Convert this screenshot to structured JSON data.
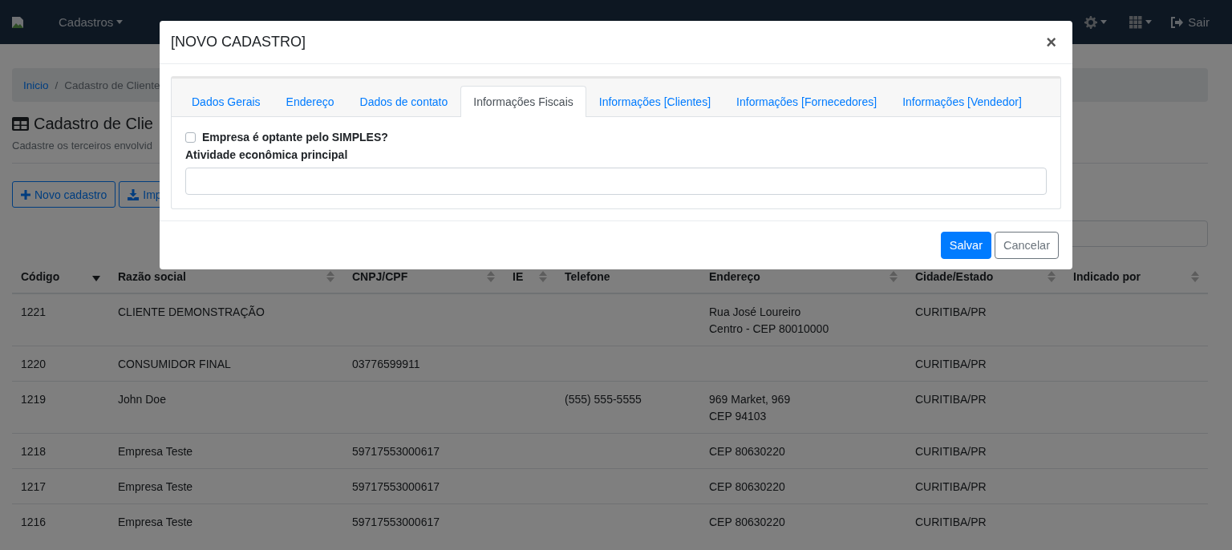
{
  "navbar": {
    "menus": [
      {
        "label": "Cadastros",
        "caret": true
      }
    ],
    "tools": [
      {
        "kind": "gear"
      },
      {
        "kind": "grid"
      }
    ],
    "logout": "Sair"
  },
  "breadcrumb": {
    "separator": "/",
    "items": [
      {
        "label": "Inicio",
        "link": true
      },
      {
        "label": "Cadastro de Cliente",
        "link": false
      }
    ]
  },
  "page": {
    "title": "Cadastro de Clie",
    "subtitle": "Cadastre os terceiros envolvid"
  },
  "actions": [
    {
      "label": "Novo cadastro",
      "kind": "plus"
    },
    {
      "label": "Imp",
      "kind": "download"
    }
  ],
  "table": {
    "columns": [
      {
        "label": "Código",
        "sortable": true,
        "sorted": true
      },
      {
        "label": "Razão social",
        "sortable": true,
        "sorted": false
      },
      {
        "label": "CNPJ/CPF",
        "sortable": true,
        "sorted": false
      },
      {
        "label": "IE",
        "sortable": true,
        "sorted": false
      },
      {
        "label": "Telefone",
        "sortable": false
      },
      {
        "label": "Endereço",
        "sortable": true,
        "sorted": false
      },
      {
        "label": "Cidade/Estado",
        "sortable": true,
        "sorted": false
      },
      {
        "label": "Indicado por",
        "sortable": true,
        "sorted": false
      }
    ],
    "rows": [
      {
        "cells": [
          "1221",
          "CLIENTE DEMONSTRAÇÃO",
          null,
          null,
          null,
          [
            "Rua José Loureiro",
            "Centro - CEP 80010000"
          ],
          "CURITIBA/PR",
          null
        ]
      },
      {
        "cells": [
          "1220",
          "CONSUMIDOR FINAL",
          "03776599911",
          null,
          null,
          null,
          "CURITIBA/PR",
          null
        ]
      },
      {
        "cells": [
          "1219",
          "John Doe",
          null,
          null,
          "(555) 555-5555",
          [
            "969 Market, 969",
            "CEP 94103"
          ],
          "CURITIBA/PR",
          null
        ]
      },
      {
        "cells": [
          "1218",
          "Empresa Teste",
          "59717553000617",
          null,
          null,
          "CEP 80630220",
          "CURITIBA/PR",
          null
        ]
      },
      {
        "cells": [
          "1217",
          "Empresa Teste",
          "59717553000617",
          null,
          null,
          "CEP 80630220",
          "CURITIBA/PR",
          null
        ]
      },
      {
        "cells": [
          "1216",
          "Empresa Teste",
          "59717553000617",
          null,
          null,
          "CEP 80630220",
          "CURITIBA/PR",
          null
        ]
      }
    ]
  },
  "modal": {
    "title": "[NOVO CADASTRO]",
    "close": "×",
    "tabs": [
      {
        "label": "Dados Gerais",
        "selected": false
      },
      {
        "label": "Endereço",
        "selected": false
      },
      {
        "label": "Dados de contato",
        "selected": false
      },
      {
        "label": "Informações Fiscais",
        "selected": true
      },
      {
        "label": "Informações [Clientes]",
        "selected": false
      },
      {
        "label": "Informações [Fornecedores]",
        "selected": false
      },
      {
        "label": "Informações [Vendedor]",
        "selected": false
      }
    ],
    "checkbox": {
      "label": "Empresa é optante pelo SIMPLES?",
      "checked": false
    },
    "field": {
      "label": "Atividade econômica principal"
    },
    "buttons": [
      {
        "label": "Salvar",
        "kind": "primary"
      },
      {
        "label": "Cancelar",
        "kind": "secondary"
      }
    ]
  }
}
